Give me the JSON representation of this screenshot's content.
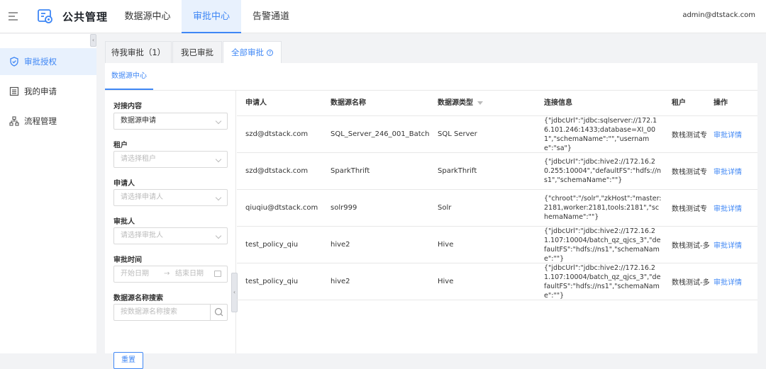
{
  "header": {
    "app_title": "公共管理",
    "nav": [
      "数据源中心",
      "审批中心",
      "告警通道"
    ],
    "active_nav": 1,
    "user": "admin@dtstack.com"
  },
  "sidebar": {
    "items": [
      {
        "label": "审批授权",
        "icon": "shield-icon",
        "active": true
      },
      {
        "label": "我的申请",
        "icon": "list-icon",
        "active": false
      },
      {
        "label": "流程管理",
        "icon": "flow-icon",
        "active": false
      }
    ],
    "collapse_glyph": "‹"
  },
  "tabs": [
    "待我审批（1）",
    "我已审批",
    "全部审批"
  ],
  "tab_help_glyph": "?",
  "subtab": "数据源中心",
  "filters": {
    "content_label": "对接内容",
    "content_value": "数据源申请",
    "tenant_label": "租户",
    "tenant_placeholder": "请选择租户",
    "applicant_label": "申请人",
    "applicant_placeholder": "请选择申请人",
    "approver_label": "审批人",
    "approver_placeholder": "请选择审批人",
    "time_label": "审批时间",
    "start_placeholder": "开始日期",
    "date_arrow": "→",
    "end_placeholder": "结束日期",
    "search_label": "数据源名称搜索",
    "search_placeholder": "按数据源名称搜索",
    "reset_label": "重置",
    "drag_glyph": "‹"
  },
  "table": {
    "columns": [
      "申请人",
      "数据源名称",
      "数据源类型",
      "连接信息",
      "租户",
      "操作"
    ],
    "rows": [
      {
        "applicant": "szd@dtstack.com",
        "name": "SQL_Server_246_001_Batch",
        "type": "SQL Server",
        "conn": "{\"jdbcUrl\":\"jdbc:sqlserver://172.16.101.246:1433;database=XI_001\",\"schemaName\":\"\",\"username\":\"sa\"}",
        "tenant": "数栈测试专",
        "action": "审批详情"
      },
      {
        "applicant": "szd@dtstack.com",
        "name": "SparkThrift",
        "type": "SparkThrift",
        "conn": "{\"jdbcUrl\":\"jdbc:hive2://172.16.20.255:10004\",\"defaultFS\":\"hdfs://ns1\",\"schemaName\":\"\"}",
        "tenant": "数栈测试专",
        "action": "审批详情"
      },
      {
        "applicant": "qiuqiu@dtstack.com",
        "name": "solr999",
        "type": "Solr",
        "conn": "{\"chroot\":\"/solr\",\"zkHost\":\"master:2181,worker:2181,tools:2181\",\"schemaName\":\"\"}",
        "tenant": "数栈测试专",
        "action": "审批详情"
      },
      {
        "applicant": "test_policy_qiu",
        "name": "hive2",
        "type": "Hive",
        "conn": "{\"jdbcUrl\":\"jdbc:hive2://172.16.21.107:10004/batch_qz_qjcs_3\",\"defaultFS\":\"hdfs://ns1\",\"schemaName\":\"\"}",
        "tenant": "数栈测试-多",
        "action": "审批详情"
      },
      {
        "applicant": "test_policy_qiu",
        "name": "hive2",
        "type": "Hive",
        "conn": "{\"jdbcUrl\":\"jdbc:hive2://172.16.21.107:10004/batch_qz_qjcs_3\",\"defaultFS\":\"hdfs://ns1\",\"schemaName\":\"\"}",
        "tenant": "数栈测试-多",
        "action": "审批详情"
      }
    ]
  },
  "colors": {
    "accent": "#3f87f5",
    "active_bg": "#e8f1fd"
  }
}
